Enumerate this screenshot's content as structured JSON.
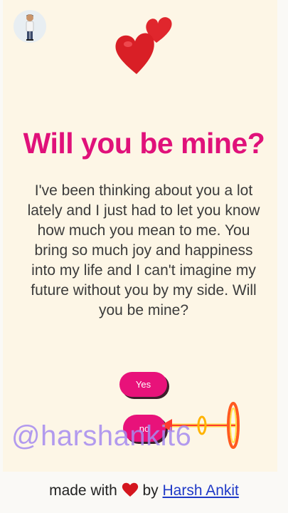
{
  "header": {
    "avatar_icon": "person-avatar-icon",
    "decoration_icon": "two-hearts-icon"
  },
  "main": {
    "title": "Will you be mine?",
    "message": "I've been thinking about you a lot lately and I just had to let you know how much you mean to me. You bring so much joy and happiness into my life and I can't imagine my future without you by my side. Will you be mine?",
    "yes_label": "Yes",
    "no_label": "no"
  },
  "overlay": {
    "watermark": "@harshankit6",
    "cursor_icon": "glowing-arrow-cursor-icon"
  },
  "footer": {
    "prefix": "made with",
    "heart_icon": "heart-icon",
    "by": "by",
    "author_link": "Harsh Ankit"
  },
  "colors": {
    "accent": "#e0117a",
    "button": "#e8127a",
    "link": "#1f39c7",
    "background": "#fdf6e6",
    "watermark": "#a58bf0"
  }
}
